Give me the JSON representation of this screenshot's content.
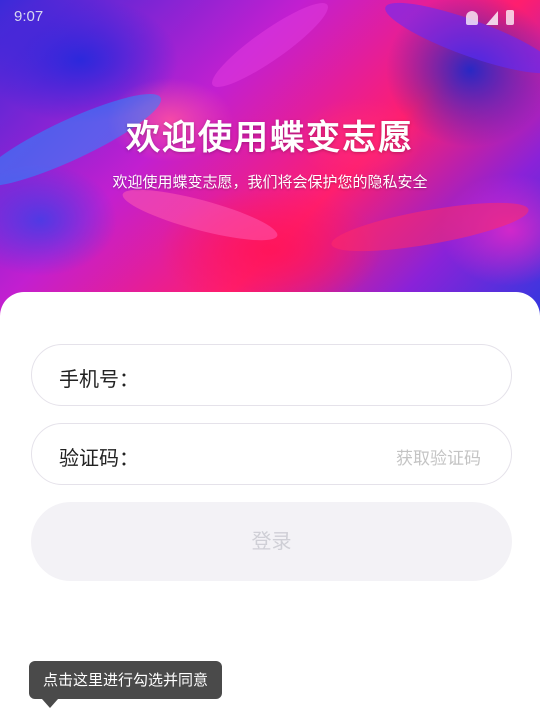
{
  "status_bar": {
    "time": "9:07"
  },
  "hero": {
    "title": "欢迎使用蝶变志愿",
    "subtitle": "欢迎使用蝶变志愿，我们将会保护您的隐私安全"
  },
  "form": {
    "phone_label": "手机号：",
    "code_label": "验证码：",
    "get_code_label": "获取验证码",
    "login_label": "登录"
  },
  "tooltip": {
    "text": "点击这里进行勾选并同意"
  },
  "colors": {
    "hero_pink": "#ff1e6e",
    "hero_blue": "#3a2ad8",
    "field_border": "#e5e2ea",
    "button_bg": "#f3f2f6",
    "tooltip_bg": "#4a4a4a"
  }
}
